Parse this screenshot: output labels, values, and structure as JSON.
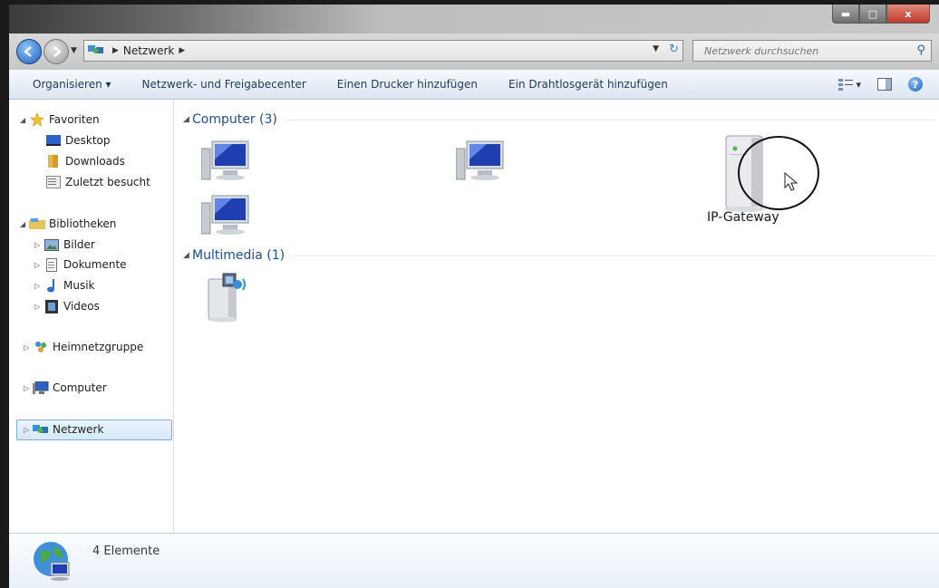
{
  "window": {
    "minimize_label": "▬",
    "maximize_label": "□",
    "close_label": "x"
  },
  "address": {
    "crumb": "Netzwerk",
    "search_placeholder": "Netzwerk durchsuchen"
  },
  "toolbar": {
    "organize": "Organisieren ▾",
    "network_center": "Netzwerk- und Freigabecenter",
    "add_printer": "Einen Drucker hinzufügen",
    "add_wireless": "Ein Drahtlosgerät hinzufügen",
    "help": "?"
  },
  "nav": {
    "favorites": "Favoriten",
    "desktop": "Desktop",
    "downloads": "Downloads",
    "recent": "Zuletzt besucht",
    "libraries": "Bibliotheken",
    "pictures": "Bilder",
    "documents": "Dokumente",
    "music": "Musik",
    "videos": "Videos",
    "homegroup": "Heimnetzgruppe",
    "computer": "Computer",
    "network": "Netzwerk"
  },
  "groups": {
    "computer": "Computer (3)",
    "multimedia": "Multimedia (1)"
  },
  "items": {
    "gateway": "IP-Gateway"
  },
  "details": {
    "count": "4 Elemente"
  },
  "colors": {
    "accent": "#1e4f96",
    "selection": "#d7e8fb"
  }
}
